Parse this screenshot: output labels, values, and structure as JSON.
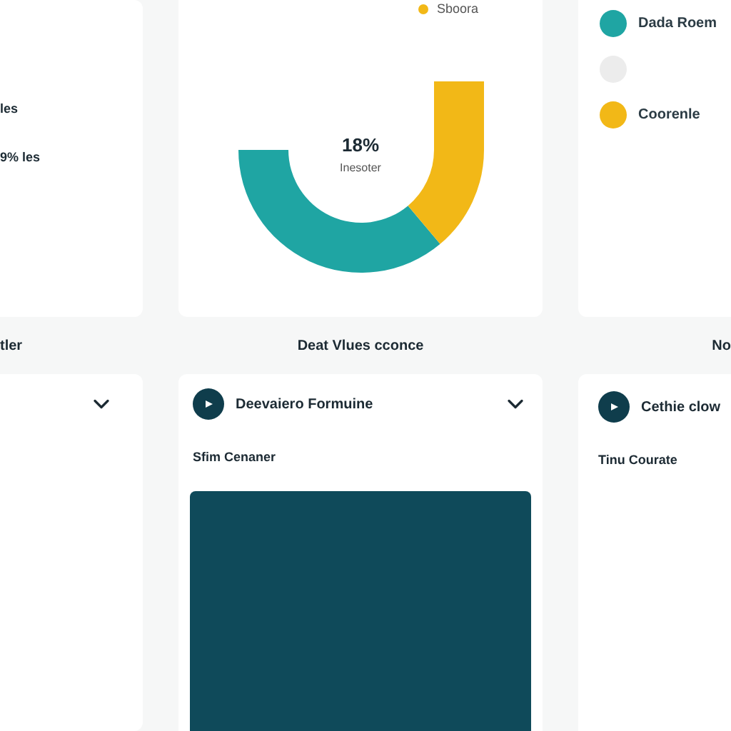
{
  "left": {
    "rows": [
      "les",
      "9% les"
    ],
    "caption": "tler"
  },
  "center": {
    "legend": [
      {
        "label": "Sboora",
        "color": "#f2b817"
      }
    ],
    "donut": {
      "value": "18%",
      "label": "Inesoter"
    },
    "caption": "Deat Vlues cconce",
    "section": {
      "title": "Deevaiero Formuine",
      "subtitle": "Sfim Cenaner",
      "expanded": true
    }
  },
  "right": {
    "legend": [
      {
        "label": "Dada Roem",
        "color": "#1fa5a3"
      },
      {
        "color": "#ececec"
      },
      {
        "label": "Coorenle",
        "color": "#f2b817"
      }
    ],
    "caption": "No",
    "section": {
      "title": "Cethie clow",
      "subtitle": "Tinu Courate"
    }
  }
}
